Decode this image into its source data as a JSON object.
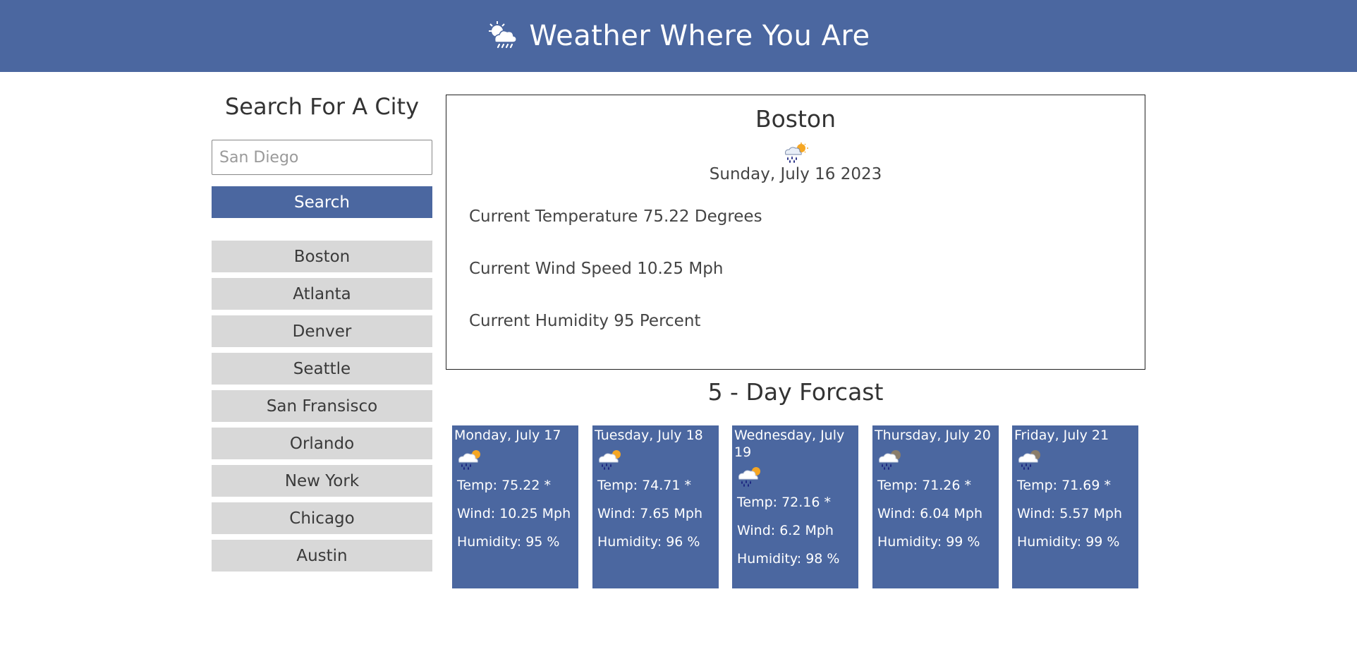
{
  "header": {
    "title": "Weather Where You Are",
    "icon": "cloud-sun-rain-icon"
  },
  "search": {
    "heading": "Search For A City",
    "placeholder": "San Diego",
    "button_label": "Search"
  },
  "cities": [
    "Boston",
    "Atlanta",
    "Denver",
    "Seattle",
    "San Fransisco",
    "Orlando",
    "New York",
    "Chicago",
    "Austin"
  ],
  "current": {
    "city": "Boston",
    "icon": "rain-sun-icon",
    "date": "Sunday, July 16 2023",
    "temperature": "Current Temperature 75.22 Degrees",
    "wind": "Current Wind Speed 10.25 Mph",
    "humidity": "Current Humidity 95 Percent"
  },
  "forecast": {
    "heading": "5 - Day Forcast",
    "days": [
      {
        "date": "Monday, July 17",
        "icon": "rain-sun-icon",
        "temp": "Temp: 75.22 *",
        "wind": "Wind: 10.25 Mph",
        "humidity": "Humidity: 95 %"
      },
      {
        "date": "Tuesday, July 18",
        "icon": "rain-sun-icon",
        "temp": "Temp: 74.71 *",
        "wind": "Wind: 7.65 Mph",
        "humidity": "Humidity: 96 %"
      },
      {
        "date": "Wednesday, July 19",
        "icon": "rain-sun-icon",
        "temp": "Temp: 72.16 *",
        "wind": "Wind: 6.2 Mph",
        "humidity": "Humidity: 98 %"
      },
      {
        "date": "Thursday, July 20",
        "icon": "rain-cloud-icon",
        "temp": "Temp: 71.26 *",
        "wind": "Wind: 6.04 Mph",
        "humidity": "Humidity: 99 %"
      },
      {
        "date": "Friday, July 21",
        "icon": "rain-cloud-icon",
        "temp": "Temp: 71.69 *",
        "wind": "Wind: 5.57 Mph",
        "humidity": "Humidity: 99 %"
      }
    ]
  },
  "colors": {
    "primary": "#4b67a0",
    "city_button": "#d8d8d8",
    "rain_drop": "#1a237e",
    "sun": "#f5a623"
  }
}
